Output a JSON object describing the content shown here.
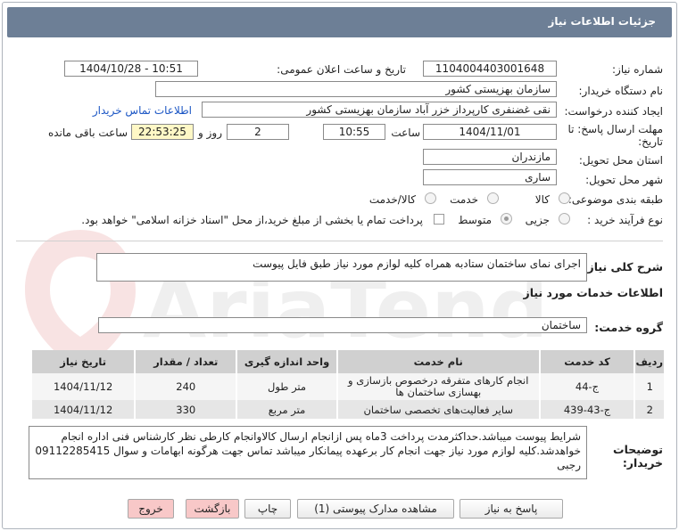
{
  "header": {
    "title": "جزئیات اطلاعات نیاز"
  },
  "fields": {
    "need_number_label": "شماره نیاز:",
    "need_number": "1104004403001648",
    "announce_label": "تاریخ و ساعت اعلان عمومی:",
    "announce_value": "1404/10/28 - 10:51",
    "buyer_org_label": "نام دستگاه خریدار:",
    "buyer_org": "سازمان بهزیستی کشور",
    "creator_label": "ایجاد کننده درخواست:",
    "creator": "نقی غضنفری کارپرداز خزر آباد سازمان بهزیستی کشور",
    "contact_link": "اطلاعات تماس خریدار",
    "deadline_label_1": "مهلت ارسال پاسخ: تا",
    "deadline_label_2": "تاریخ:",
    "deadline_date": "1404/11/01",
    "time_label": "ساعت",
    "deadline_time": "10:55",
    "days_value": "2",
    "days_label": "روز و",
    "remaining_value": "22:53:25",
    "remaining_label": "ساعت باقی مانده",
    "province_label": "استان محل تحویل:",
    "province": "مازندران",
    "city_label": "شهر محل تحویل:",
    "city": "ساری",
    "category_label": "طبقه بندی موضوعی:",
    "category_options": [
      "کالا",
      "خدمت",
      "کالا/خدمت"
    ],
    "process_label": "نوع فرآیند خرید :",
    "process_options": [
      "جزیی",
      "متوسط"
    ],
    "payment_note": "پرداخت تمام یا بخشی از مبلغ خرید،از محل \"اسناد خزانه اسلامی\" خواهد بود."
  },
  "summary": {
    "label": "شرح کلی نیاز:",
    "text": "اجرای نمای ساختمان  ستادبه همراه کلیه لوازم مورد نیاز طبق فایل پیوست"
  },
  "services": {
    "section_title": "اطلاعات خدمات مورد نیاز",
    "group_label": "گروه خدمت:",
    "group_value": "ساختمان",
    "columns": [
      "ردیف",
      "کد خدمت",
      "نام خدمت",
      "واحد اندازه گیری",
      "تعداد / مقدار",
      "تاریخ نیاز"
    ],
    "rows": [
      {
        "row": "1",
        "code": "ج-44",
        "name": "انجام کارهای متفرقه درخصوص بازسازی و بهسازی ساختمان ها",
        "unit": "متر طول",
        "qty": "240",
        "date": "1404/11/12"
      },
      {
        "row": "2",
        "code": "ج-43-439",
        "name": "سایر فعالیت‌های تخصصی ساختمان",
        "unit": "متر مربع",
        "qty": "330",
        "date": "1404/11/12"
      }
    ]
  },
  "buyer_notes": {
    "label_1": "توضیحات",
    "label_2": "خریدار:",
    "text": "شرایط پیوست میباشد.حداکثرمدت پرداخت 3ماه پس ازانجام ارسال کالاوانجام کارطی نظر کارشناس فنی اداره انجام خواهدشد.کلیه لوازم مورد نیاز جهت انجام کار برعهده پیمانکار میباشد تماس جهت هرگونه ابهامات و سوال 09112285415 رجبی"
  },
  "buttons": {
    "reply": "پاسخ به نیاز",
    "attachments": "مشاهده مدارک پیوستی (1)",
    "print": "چاپ",
    "back": "بازگشت",
    "exit": "خروج"
  },
  "watermark": "AriaTender.net",
  "colors": {
    "header_bg": "#6d7f96",
    "table_header_bg": "#d0d0d0",
    "link": "#1a55c4",
    "highlight_bg": "#fff8c6",
    "pink_button": "#f8c8c8"
  },
  "icons": {
    "watermark_logo": "aria-tender-logo"
  }
}
